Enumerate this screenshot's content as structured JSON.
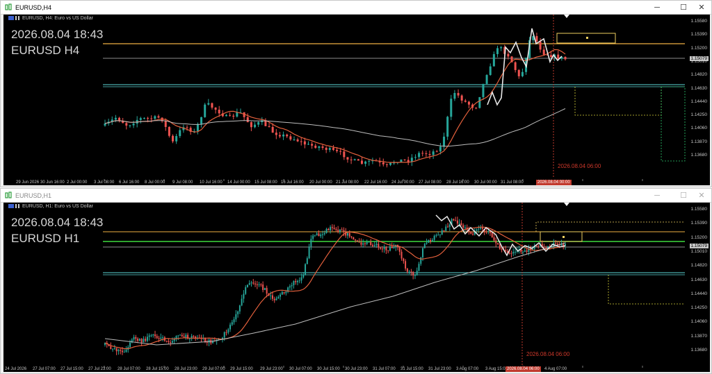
{
  "colors": {
    "background": "#000000",
    "bull_candle": "#26a69a",
    "bear_candle": "#ef5350",
    "orange_line": "#f0b042",
    "green_line": "#3ddc3d",
    "white_line": "#e8e8e8",
    "grey_ma": "#bdbdbd",
    "red_ma": "#e4603c",
    "vertical_line": "#c23a2e"
  },
  "windows": [
    {
      "title": "EURUSD,H4",
      "info": "EURUSD, H4:  Euro vs US Dollar",
      "big_date": "2026.08.04 18:43",
      "big_symbol": "EURUSD H4",
      "price_labels": [
        "1.15580",
        "1.15390",
        "1.15200",
        "1.15010",
        "1.14820",
        "1.14630",
        "1.14440",
        "1.14250",
        "1.14060",
        "1.13870",
        "1.13680"
      ],
      "current_price": "1.15079",
      "time_labels": [
        "29 Jun 2026",
        "30 Jun 16:00",
        "2 Jul 00:00",
        "3 Jul 08:00",
        "6 Jul 16:00",
        "8 Jul 00:00",
        "9 Jul 08:00",
        "10 Jul 16:00",
        "14 Jul 00:00",
        "15 Jul 08:00",
        "16 Jul 16:00",
        "20 Jul 00:00",
        "21 Jul 08:00",
        "22 Jul 16:00",
        "24 Jul 00:00",
        "27 Jul 08:00",
        "28 Jul 16:00",
        "30 Jul 00:00",
        "31 Jul 08:00",
        "4 Aug 08:00"
      ],
      "time_tag": "2026.08.04 00:00",
      "vline_label": "2026.08.04 06:00",
      "controls": {
        "minimize": "─",
        "maximize": "☐",
        "close": "✕"
      }
    },
    {
      "title": "EURUSD,H1",
      "info": "EURUSD, H1:  Euro vs US Dollar",
      "big_date": "2026.08.04 18:43",
      "big_symbol": "EURUSD H1",
      "price_labels": [
        "1.15580",
        "1.15390",
        "1.15200",
        "1.15010",
        "1.14820",
        "1.14630",
        "1.14440",
        "1.14250",
        "1.14060",
        "1.13870",
        "1.13680"
      ],
      "current_price": "1.15079",
      "time_labels": [
        "24 Jul 2026",
        "27 Jul 07:00",
        "27 Jul 15:00",
        "27 Jul 23:00",
        "28 Jul 07:00",
        "28 Jul 15:00",
        "28 Jul 23:00",
        "29 Jul 07:00",
        "29 Jul 15:00",
        "29 Jul 23:00",
        "30 Jul 07:00",
        "30 Jul 15:00",
        "30 Jul 23:00",
        "31 Jul 07:00",
        "31 Jul 15:00",
        "31 Jul 23:00",
        "3 Aug 07:00",
        "3 Aug 15:00",
        "4 Aug 07:00"
      ],
      "time_tag": "2026.08.04 06:00",
      "vline_label": "2026.08.04 06:00",
      "controls": {
        "minimize": "─",
        "maximize": "☐",
        "close": "✕"
      }
    }
  ]
}
